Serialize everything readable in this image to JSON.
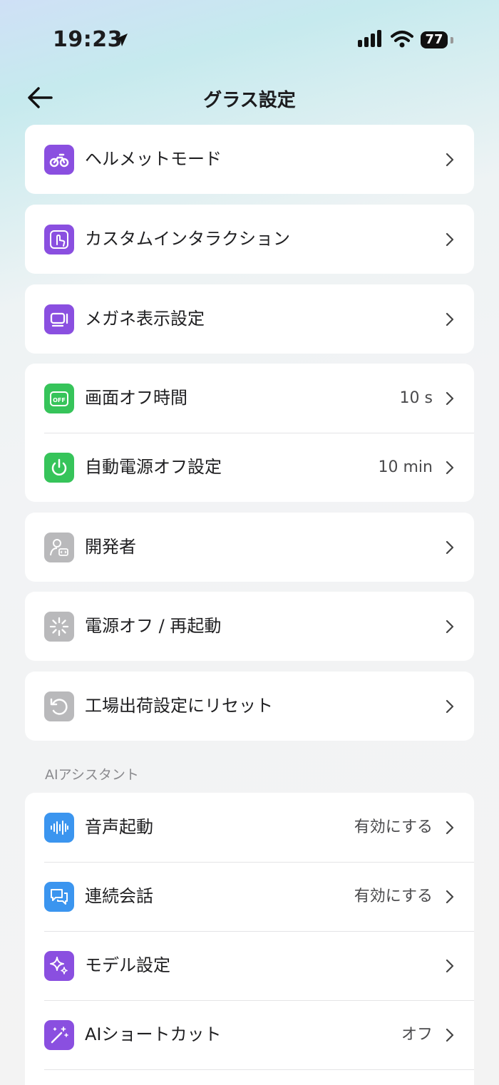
{
  "status": {
    "time": "19:23",
    "battery": "77"
  },
  "header": {
    "title": "グラス設定"
  },
  "settings": {
    "helmet": {
      "label": "ヘルメットモード"
    },
    "custom": {
      "label": "カスタムインタラクション"
    },
    "display": {
      "label": "メガネ表示設定"
    },
    "screen_off": {
      "label": "画面オフ時間",
      "value": "10 s"
    },
    "auto_power": {
      "label": "自動電源オフ設定",
      "value": "10 min"
    },
    "developer": {
      "label": "開発者"
    },
    "power": {
      "label": "電源オフ / 再起動"
    },
    "reset": {
      "label": "工場出荷設定にリセット"
    }
  },
  "ai": {
    "section_title": "AIアシスタント",
    "voice_wake": {
      "label": "音声起動",
      "value": "有効にする"
    },
    "continuous": {
      "label": "連続会話",
      "value": "有効にする"
    },
    "model": {
      "label": "モデル設定"
    },
    "shortcut": {
      "label": "AIショートカット",
      "value": "オフ"
    }
  },
  "colors": {
    "purple": "#8a4fe0",
    "green": "#36c45a",
    "gray": "#b9b9bb",
    "blue": "#3b95ef"
  }
}
